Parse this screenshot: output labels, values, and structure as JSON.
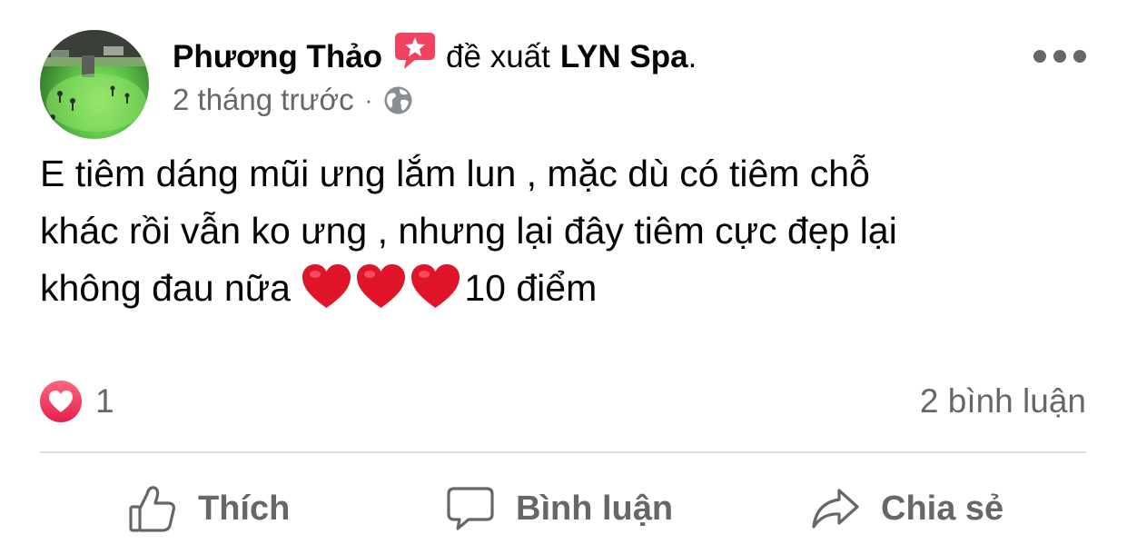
{
  "post": {
    "author": "Phương Thảo",
    "recommend_icon": "recommend-star-icon",
    "recommend_text": "đề xuất",
    "page_name": "LYN Spa",
    "period": ".",
    "time": "2 tháng trước",
    "separator": "·",
    "privacy_icon": "globe-icon",
    "more_icon": "more-horizontal-icon",
    "body_lines": [
      "E tiêm dáng mũi ưng lắm lun , mặc dù có tiêm chỗ",
      "khác rồi vẫn ko ưng , nhưng lại đây tiêm cực đẹp lại",
      "không đau nữa"
    ],
    "body_emoji": "heart-emoji",
    "body_emoji_count": 3,
    "body_tail": "10 điểm"
  },
  "stats": {
    "reaction_icon": "love-reaction-icon",
    "reaction_count": "1",
    "comment_count": "2 bình luận"
  },
  "actions": {
    "like": "Thích",
    "comment": "Bình luận",
    "share": "Chia sẻ"
  },
  "colors": {
    "text_primary": "#050505",
    "text_secondary": "#65676b",
    "divider": "#dadde1",
    "recommend_accent": "#f3425f",
    "love_reaction": "#f33e58",
    "heart_emoji": "#e0152a"
  }
}
